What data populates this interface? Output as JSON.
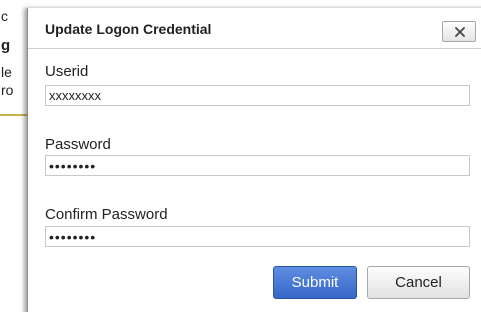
{
  "background": {
    "lines": [
      "c",
      "g",
      "le",
      "ro"
    ]
  },
  "dialog": {
    "title": "Update Logon Credential",
    "close_icon": "close-icon",
    "fields": {
      "userid": {
        "label": "Userid",
        "value": "xxxxxxxx"
      },
      "password": {
        "label": "Password",
        "value": "••••••••"
      },
      "confirm": {
        "label": "Confirm Password",
        "value": "••••••••"
      }
    },
    "buttons": {
      "submit": "Submit",
      "cancel": "Cancel"
    }
  },
  "colors": {
    "submit_bg": "#3f72d3",
    "underline_accent": "#c9b24c"
  }
}
